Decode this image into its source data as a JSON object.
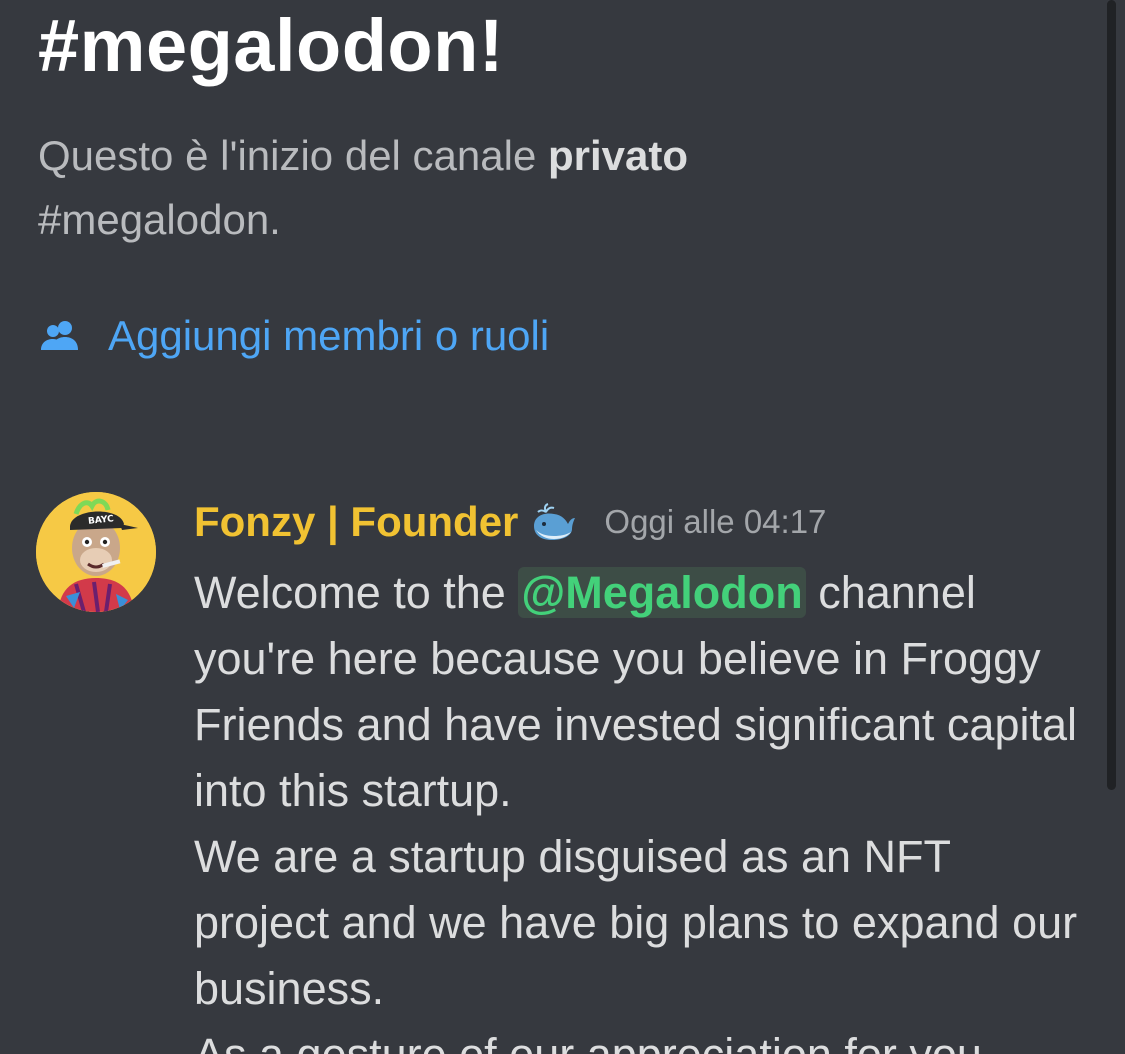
{
  "channel": {
    "title": "#megalodon!",
    "description_prefix": "Questo è l'inizio del canale ",
    "description_bold": "privato",
    "description_suffix": "#megalodon."
  },
  "actions": {
    "add_members_label": "Aggiungi membri o ruoli",
    "add_members_icon": "members-icon"
  },
  "message": {
    "author": "Fonzy | Founder",
    "author_color": "#f1c232",
    "badge_icon": "whale-emoji-icon",
    "timestamp": "Oggi alle 04:17",
    "body_before_mention": "Welcome to the ",
    "mention": "@Megalodon",
    "body_after_mention": " channel you're here because you believe in Froggy Friends and have invested significant capital into this startup.",
    "body_line2": "We are a startup disguised as an NFT project and we have big plans to expand our business.",
    "body_line3": "As a gesture of our appreciation for you"
  },
  "colors": {
    "background": "#36393f",
    "link": "#4ea6f5",
    "mention_text": "#43d17a",
    "mention_bg": "#3d4d46"
  }
}
